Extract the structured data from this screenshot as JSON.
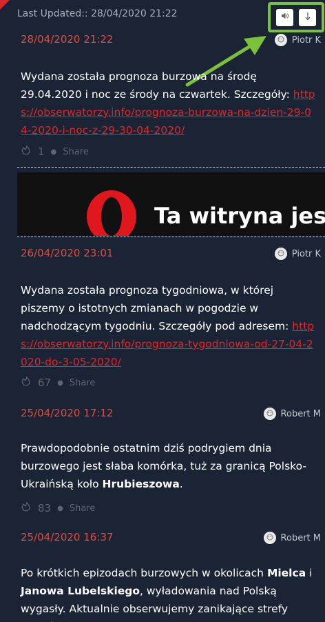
{
  "header": {
    "last_updated": "Last Updated:: 28/04/2020 21:22",
    "sound_icon": "speaker-icon",
    "down_icon": "down-arrow-icon"
  },
  "posts": [
    {
      "time": "28/04/2020 21:22",
      "author": "Piotr K",
      "text_before_link": "Wydana została prognoza burzowa na środę 29.04.2020 i noc ze środy na czwartek. Szczegóły:",
      "link": "https://obserwatorzy.info/prognoza-burzowa-na-dzien-29-04-2020-i-noc-z-29-30-04-2020/",
      "likes": "1",
      "share_label": "Share"
    },
    {
      "time": "26/04/2020 23:01",
      "author": "Piotr K",
      "text_before_link": "Wydana została prognoza tygodniowa, w której piszemy o istotnych zmianach w pogodzie w nadchodzącym tygodniu. Szczegóły pod adresem:",
      "link": "https://obserwatorzy.info/prognoza-tygodniowa-od-27-04-2020-do-3-05-2020/",
      "likes": "67",
      "share_label": "Share"
    },
    {
      "time": "25/04/2020 17:12",
      "author": "Robert M",
      "text_part1": "Prawdopodobnie ostatnim dziś podrygiem dnia burzowego jest słaba komórka, tuż za granicą Polsko-Ukraińską koło",
      "bold1": "Hrubieszowa",
      "text_part2": ".",
      "likes": "83",
      "share_label": "Share"
    },
    {
      "time": "25/04/2020 16:37",
      "author": "Robert M",
      "text_part1": "Po krótkich epizodach burzowych w okolicach",
      "bold1": "Mielca",
      "text_part2": "i",
      "bold2": "Janowa Lubelskiego",
      "text_part3": ", wyładowania nad Polską wygasły. Aktualnie obserwujemy zanikające strefy opadów nad"
    }
  ],
  "ad": {
    "text": "Ta witryna jest n",
    "logo": "opera-logo"
  },
  "colors": {
    "background": "#1b2434",
    "accent_red": "#e34b3f",
    "link_red": "#e0262a",
    "highlight_green": "#7cc13c"
  }
}
